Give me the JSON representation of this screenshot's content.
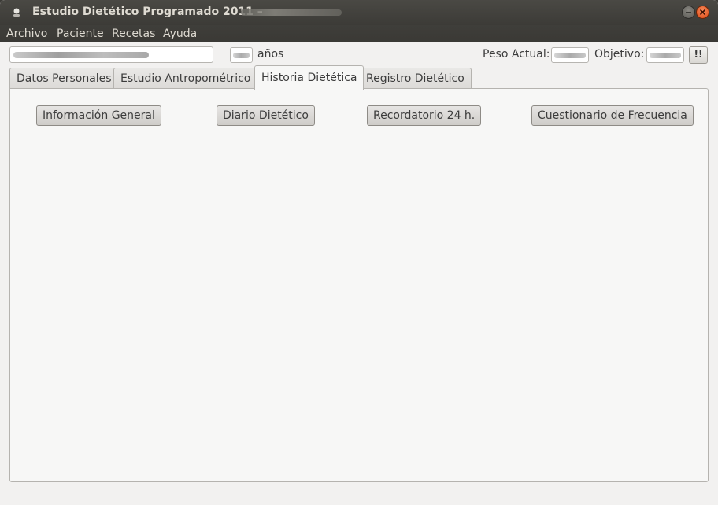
{
  "window": {
    "title": "Estudio Dietético Programado 2011 –"
  },
  "menu": {
    "items": [
      "Archivo",
      "Paciente",
      "Recetas",
      "Ayuda"
    ]
  },
  "patient": {
    "age_unit": "años",
    "weight_label": "Peso Actual:",
    "target_label": "Objetivo:",
    "alert_label": "!!"
  },
  "tabs": [
    {
      "label": "Datos Personales",
      "active": false
    },
    {
      "label": "Estudio Antropométrico",
      "active": false
    },
    {
      "label": "Historia Dietética",
      "active": true
    },
    {
      "label": "Registro Dietético",
      "active": false
    }
  ],
  "actions": {
    "general": "Información General",
    "diary": "Diario Dietético",
    "recall": "Recordatorio 24 h.",
    "frequency": "Cuestionario de Frecuencia"
  },
  "colors": {
    "titlebar": "#3c3b37",
    "close_button": "#df4a14",
    "window_bg": "#f2f1f0"
  },
  "icons": {
    "app": "app-icon",
    "minimize": "minimize-icon",
    "close": "close-icon"
  }
}
